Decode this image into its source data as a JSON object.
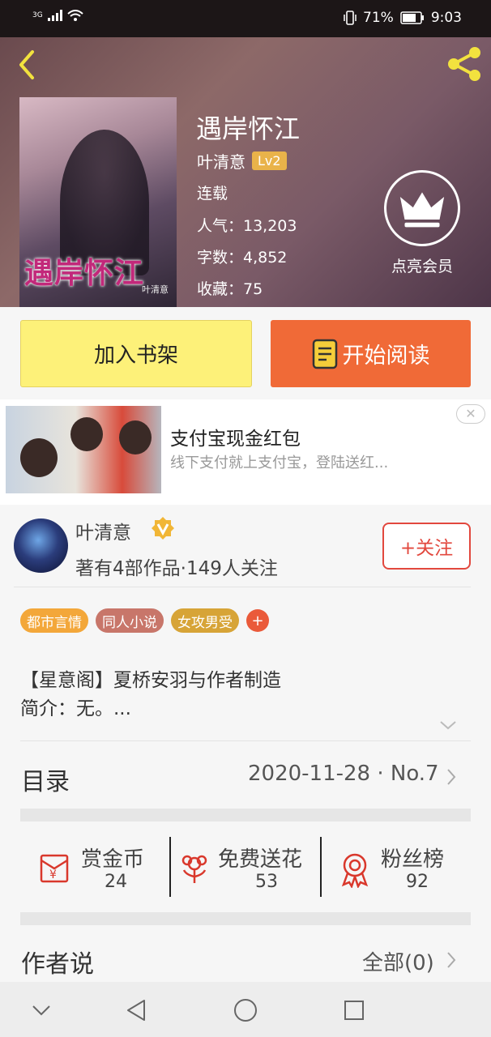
{
  "status_bar": {
    "network": "3G",
    "battery": "71%",
    "time": "9:03"
  },
  "book": {
    "cover_title": "遇岸怀江",
    "cover_author": "叶清意",
    "title": "遇岸怀江",
    "author": "叶清意",
    "level": "Lv2",
    "status": "连载",
    "popularity": "人气：13,203",
    "word_count": "字数：4,852",
    "favorites": "收藏：75"
  },
  "vip": {
    "label": "点亮会员"
  },
  "actions": {
    "add_shelf": "加入书架",
    "start_read": "开始阅读"
  },
  "ad": {
    "title": "支付宝现金红包",
    "subtitle": "线下支付就上支付宝，登陆送红...",
    "close": "✕"
  },
  "author_card": {
    "name": "叶清意",
    "stats": "著有4部作品·149人关注",
    "follow": "+关注"
  },
  "tags": [
    {
      "label": "都市言情",
      "color": "#f3a73a"
    },
    {
      "label": "同人小说",
      "color": "#c8766a"
    },
    {
      "label": "女攻男受",
      "color": "#d7a437"
    }
  ],
  "tag_add": "+",
  "intro": {
    "line1": "【星意阁】夏桥安羽与作者制造",
    "line2": "简介：无。..."
  },
  "toc": {
    "label": "目录",
    "info": "2020-11-28 · No.7"
  },
  "stats": [
    {
      "label": "赏金币",
      "value": "24",
      "icon": "red-envelope-icon"
    },
    {
      "label": "免费送花",
      "value": "53",
      "icon": "flower-icon"
    },
    {
      "label": "粉丝榜",
      "value": "92",
      "icon": "medal-icon"
    }
  ],
  "author_say": {
    "label": "作者说",
    "all": "全部(0)"
  },
  "nav": [
    "chevron-down-icon",
    "back-triangle-icon",
    "home-circle-icon",
    "recents-square-icon"
  ]
}
